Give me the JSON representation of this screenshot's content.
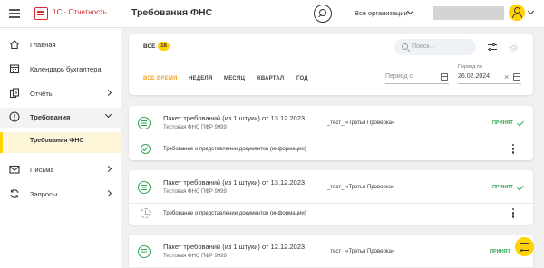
{
  "header": {
    "app_title": "1С · Отчетность",
    "page_title": "Требования ФНС",
    "org_select": "Все организации"
  },
  "sidebar": {
    "items": [
      {
        "label": "Главная"
      },
      {
        "label": "Календарь бухгалтера"
      },
      {
        "label": "Отчёты"
      },
      {
        "label": "Требования"
      },
      {
        "label": "Требования ФНС"
      },
      {
        "label": "Письма"
      },
      {
        "label": "Запросы"
      }
    ]
  },
  "filter": {
    "all_label": "ВСЕ",
    "all_count": "18",
    "search_placeholder": "Поиск...",
    "periods": [
      "ВСЕ ВРЕМЯ",
      "НЕДЕЛЯ",
      "МЕСЯЦ",
      "КВАРТАЛ",
      "ГОД"
    ],
    "active_period": "ВСЕ ВРЕМЯ",
    "date_from_placeholder": "Период с",
    "date_to_label": "Период по",
    "date_to_value": "26.02.2024"
  },
  "cards": [
    {
      "title": "Пакет требований (из 1 штуки) от 13.12.2023",
      "sub": "Тестовая ФНС ПФР 9999",
      "org": "_тест_ «Третья Проверка»",
      "status": "ПРИНЯТ",
      "row_text": "Требование о представлении документов (информации)",
      "row_state": "done"
    },
    {
      "title": "Пакет требований (из 1 штуки) от 13.12.2023",
      "sub": "Тестовая ФНС ПФР 9999",
      "org": "_тест_ «Третья Проверка»",
      "status": "ПРИНЯТ",
      "row_text": "Требование о представлении документов (информации)",
      "row_state": "pending"
    },
    {
      "title": "Пакет требований (из 1 штуки) от 12.12.2023",
      "sub": "Тестовая ФНС ПФР 9999",
      "org": "_тест_ «Третья Проверка»",
      "status": "ПРИНЯТ",
      "row_text": "",
      "row_state": ""
    }
  ],
  "colors": {
    "accent": "#ffd200",
    "brand_red": "#d9282f",
    "status_green": "#2ea44f",
    "active_period": "#f5a623"
  }
}
